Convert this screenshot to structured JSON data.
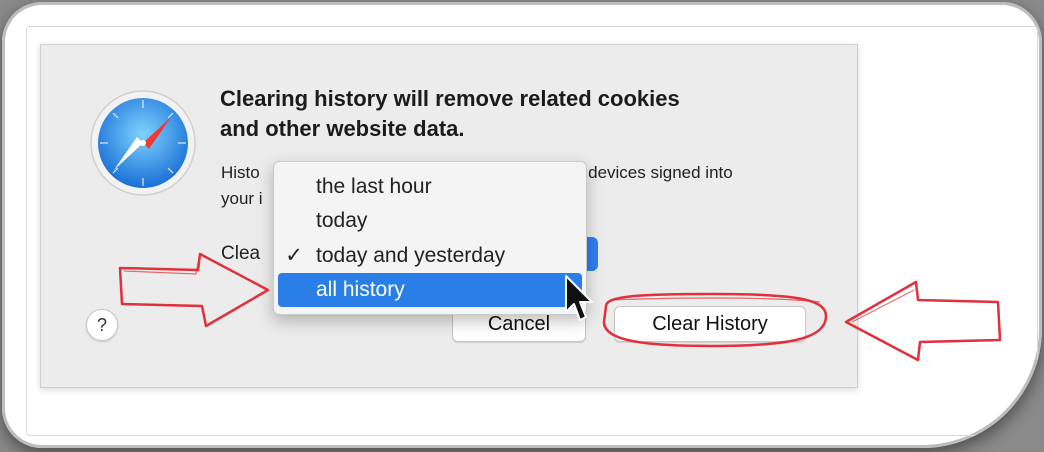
{
  "dialog": {
    "title_line1": "Clearing history will remove related cookies",
    "title_line2": "and other website data.",
    "body_line1": "Histo",
    "body_line1_end": "r devices signed into",
    "body_line2": "your i",
    "clear_label": "Clea",
    "help_label": "?",
    "cancel_label": "Cancel",
    "clear_history_label": "Clear History"
  },
  "menu": {
    "items": [
      {
        "label": "the last hour",
        "checked": false,
        "highlighted": false
      },
      {
        "label": "today",
        "checked": false,
        "highlighted": false
      },
      {
        "label": "today and yesterday",
        "checked": true,
        "highlighted": false
      },
      {
        "label": "all history",
        "checked": false,
        "highlighted": true
      }
    ],
    "check_glyph": "✓"
  },
  "colors": {
    "accent": "#2a7ee8",
    "annotation_red": "#e0303a"
  },
  "icons": {
    "app": "safari-compass-icon",
    "pointer": "mouse-pointer-icon"
  }
}
